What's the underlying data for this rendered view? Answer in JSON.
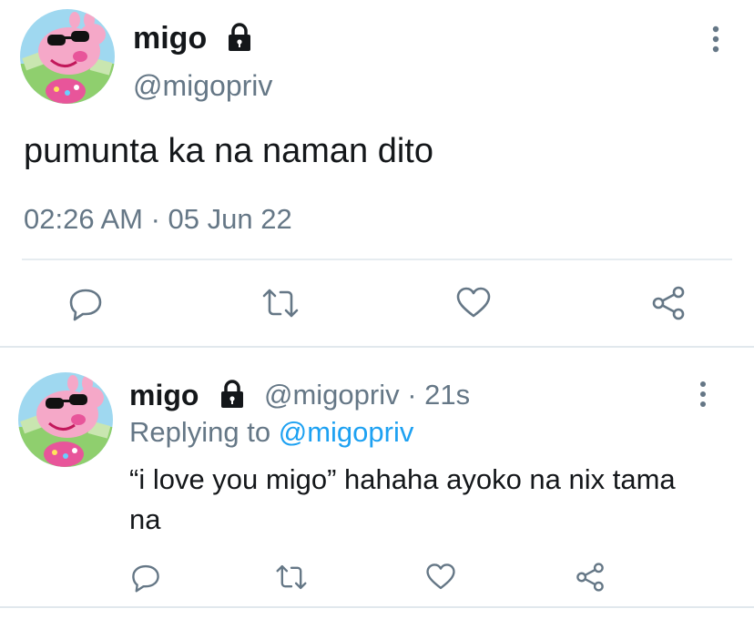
{
  "main_tweet": {
    "display_name": "migo",
    "handle": "@migopriv",
    "text": "pumunta ka na naman dito",
    "timestamp": "02:26 AM · 05 Jun 22",
    "icons": {
      "lock": "lock-icon",
      "more": "more-vertical-icon",
      "reply": "reply-icon",
      "retweet": "retweet-icon",
      "like": "heart-icon",
      "share": "share-icon"
    }
  },
  "reply_tweet": {
    "display_name": "migo",
    "handle_time": "@migopriv · 21s",
    "replying_prefix": "Replying to",
    "replying_handle": "@migopriv",
    "text": "“i love you migo” hahaha ayoko na nix tama na"
  },
  "colors": {
    "text_primary": "#14171a",
    "text_secondary": "#657786",
    "link": "#1da1f2",
    "divider": "#e6ecf0",
    "icon": "#657786",
    "avatar_pink": "#f5a8c8",
    "avatar_bg": "#8fcf6e"
  }
}
